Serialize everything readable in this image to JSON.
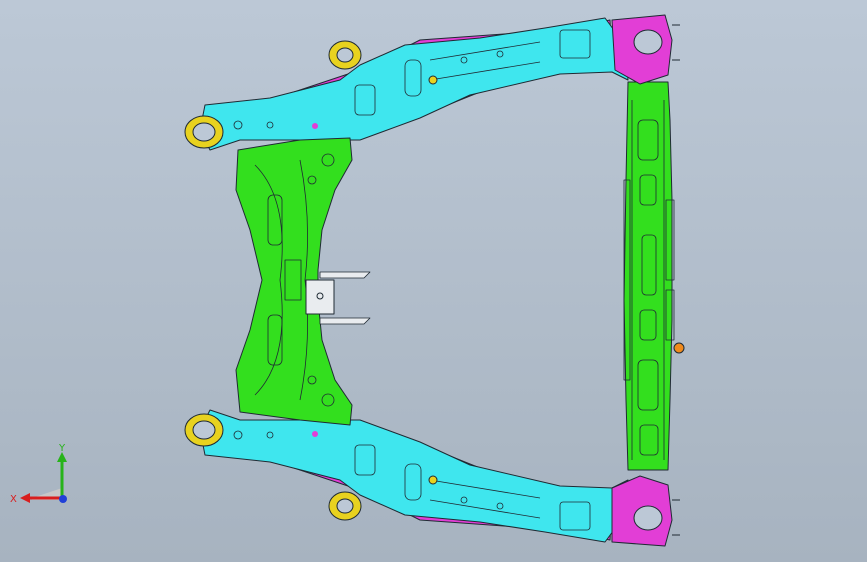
{
  "viewport": {
    "background_top": "#bcc8d6",
    "background_bottom": "#a7b3c0"
  },
  "colors": {
    "cyan": "#3fe6ee",
    "green": "#33df1e",
    "magenta": "#e23ed6",
    "yellow": "#e8d21f",
    "orange": "#f08a1c",
    "outline": "#1f2a33",
    "x_axis": "#d81e1e",
    "y_axis": "#27b31a",
    "z_axis": "#2040d8"
  },
  "triad": {
    "x_label": "X",
    "y_label": "Y"
  },
  "model": {
    "icon": "subframe-part-icon"
  }
}
